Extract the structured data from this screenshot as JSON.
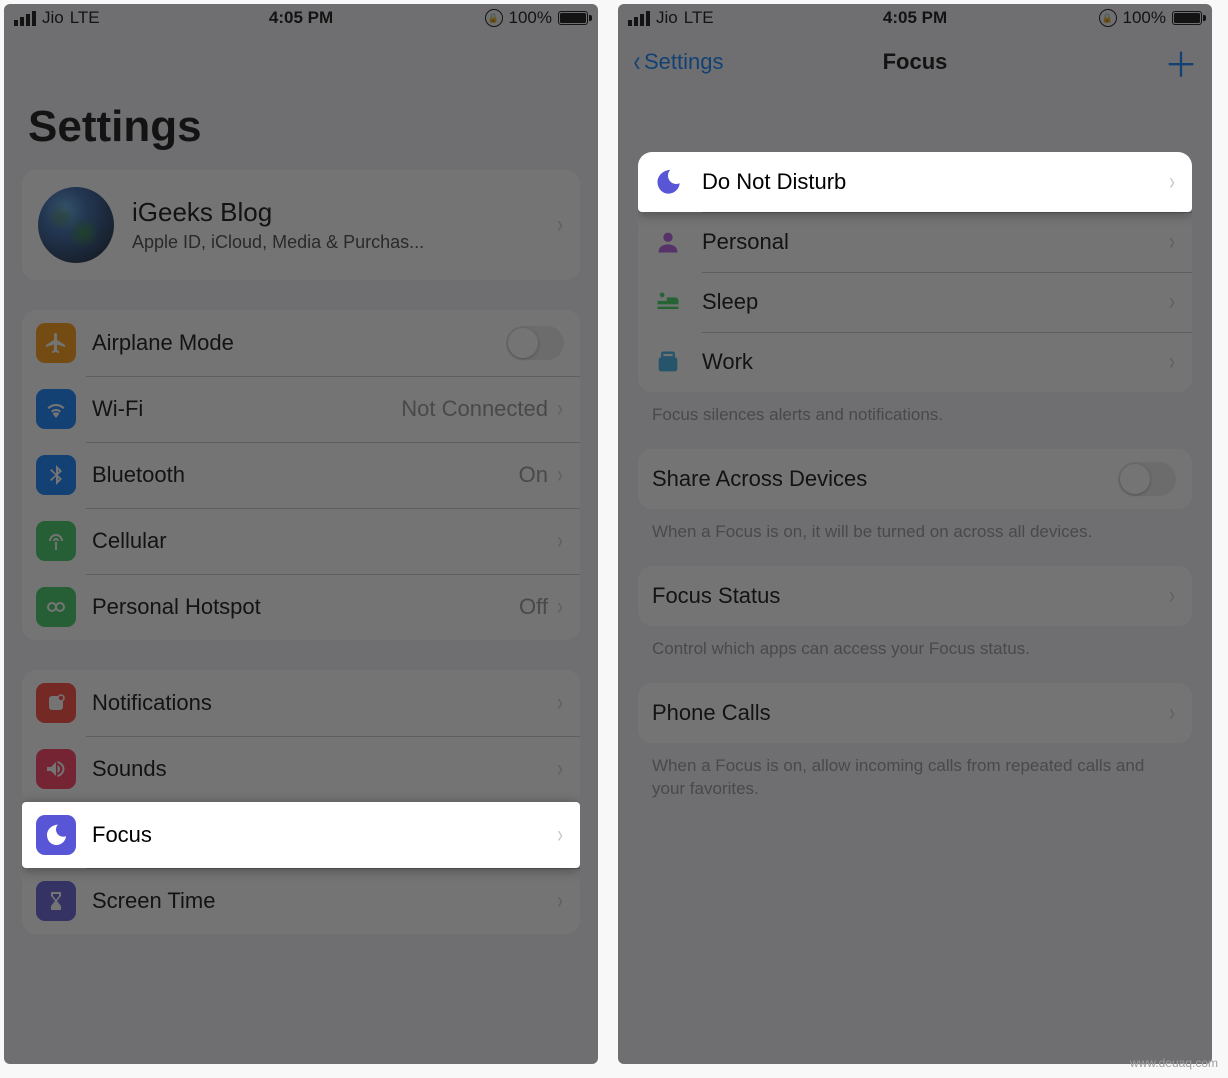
{
  "status": {
    "carrier": "Jio",
    "network": "LTE",
    "time": "4:05 PM",
    "battery_pct": "100%"
  },
  "left": {
    "title": "Settings",
    "profile": {
      "name": "iGeeks Blog",
      "sub": "Apple ID, iCloud, Media & Purchas..."
    },
    "connectivity": [
      {
        "icon": "airplane",
        "label": "Airplane Mode",
        "toggle": false
      },
      {
        "icon": "wifi",
        "label": "Wi-Fi",
        "detail": "Not Connected"
      },
      {
        "icon": "bluetooth",
        "label": "Bluetooth",
        "detail": "On"
      },
      {
        "icon": "cellular",
        "label": "Cellular"
      },
      {
        "icon": "hotspot",
        "label": "Personal Hotspot",
        "detail": "Off"
      }
    ],
    "general": [
      {
        "icon": "notifications",
        "label": "Notifications"
      },
      {
        "icon": "sounds",
        "label": "Sounds"
      },
      {
        "icon": "focus",
        "label": "Focus",
        "highlight": true
      },
      {
        "icon": "screentime",
        "label": "Screen Time"
      }
    ]
  },
  "right": {
    "back": "Settings",
    "title": "Focus",
    "modes": [
      {
        "icon": "moon",
        "label": "Do Not Disturb",
        "highlight": true
      },
      {
        "icon": "person",
        "label": "Personal"
      },
      {
        "icon": "bed",
        "label": "Sleep"
      },
      {
        "icon": "briefcase",
        "label": "Work"
      }
    ],
    "modes_footer": "Focus silences alerts and notifications.",
    "share": {
      "label": "Share Across Devices",
      "toggle": false
    },
    "share_footer": "When a Focus is on, it will be turned on across all devices.",
    "status_row": "Focus Status",
    "status_footer": "Control which apps can access your Focus status.",
    "calls_row": "Phone Calls",
    "calls_footer": "When a Focus is on, allow incoming calls from repeated calls and your favorites."
  },
  "watermark": "www.deuaq.com"
}
